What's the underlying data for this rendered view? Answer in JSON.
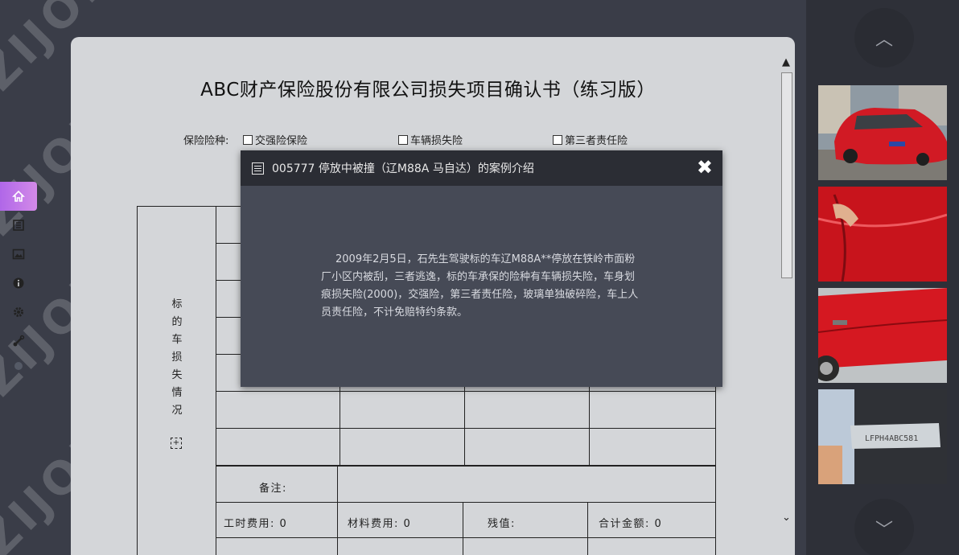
{
  "sidebar": {
    "items": [
      {
        "icon": "home-icon",
        "active": true
      },
      {
        "icon": "document-icon",
        "active": false
      },
      {
        "icon": "image-icon",
        "active": false
      },
      {
        "icon": "info-icon",
        "active": false
      },
      {
        "icon": "gear-icon",
        "active": false
      },
      {
        "icon": "tools-icon",
        "active": false
      },
      {
        "icon": "dot-icon",
        "active": false
      }
    ]
  },
  "document": {
    "title": "ABC财产保险股份有限公司损失项目确认书（练习版）",
    "insurance_label": "保险险种:",
    "insurance_options": [
      "交强险保险",
      "车辆损失险",
      "第三者责任险"
    ],
    "vertical_label": "标的车损失情况",
    "remark_label": "备注:",
    "footer_fields": [
      "工时费用: 0",
      "材料费用: 0",
      "残值:",
      "合计金额: 0"
    ],
    "scroll_up": "▲",
    "scroll_down": "⌄"
  },
  "modal": {
    "title": "005777 停放中被撞（辽M88A 马自达）的案例介绍",
    "close": "✖",
    "body": "2009年2月5日，石先生驾驶标的车辽M88A**停放在铁岭市面粉厂小区内被刮，三者逃逸，标的车承保的险种有车辆损失险，车身划痕损失险(2000)，交强险，第三者责任险，玻璃单独破碎险，车上人员责任险，不计免赔特约条款。"
  },
  "gallery": {
    "up": "︿",
    "down": "﹀",
    "photos": [
      {
        "name": "car-photo-front",
        "plate": ""
      },
      {
        "name": "car-photo-door-scratch",
        "plate": ""
      },
      {
        "name": "car-photo-side",
        "plate": ""
      },
      {
        "name": "vin-photo",
        "plate": "LFPH4ABC581"
      }
    ]
  },
  "colors": {
    "background": "#3a3d48",
    "document": "#d4d6d9",
    "modal": "#464a56",
    "modal_header": "#2b2d34",
    "active_nav": "#c07ae8",
    "car_red": "#d11a24"
  },
  "watermark": "ZIJOE"
}
